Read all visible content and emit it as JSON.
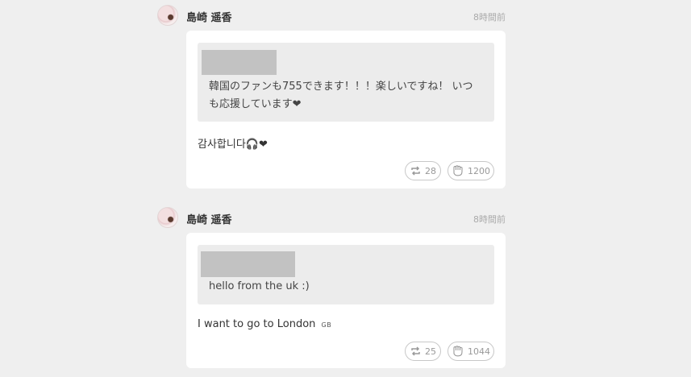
{
  "posts": [
    {
      "author": "島崎 遥香",
      "time": "8時間前",
      "quote_text": "韓国のファンも755できます！！！楽しいですね！ いつも応援しています❤",
      "reply_text": "감사합니다🎧❤",
      "reply_suffix": "",
      "repost_count": "28",
      "like_count": "1200"
    },
    {
      "author": "島崎 遥香",
      "time": "8時間前",
      "quote_text": "hello from the uk :)",
      "reply_text": "I want to go to London",
      "reply_suffix": "GB",
      "repost_count": "25",
      "like_count": "1044"
    }
  ],
  "icons": {
    "repost": "repost-icon",
    "like": "clap-hand-icon",
    "avatar": "avatar"
  },
  "colors": {
    "background": "#efefef",
    "card": "#ffffff",
    "quote": "#ececec",
    "redacted": "#c2c2c2"
  }
}
